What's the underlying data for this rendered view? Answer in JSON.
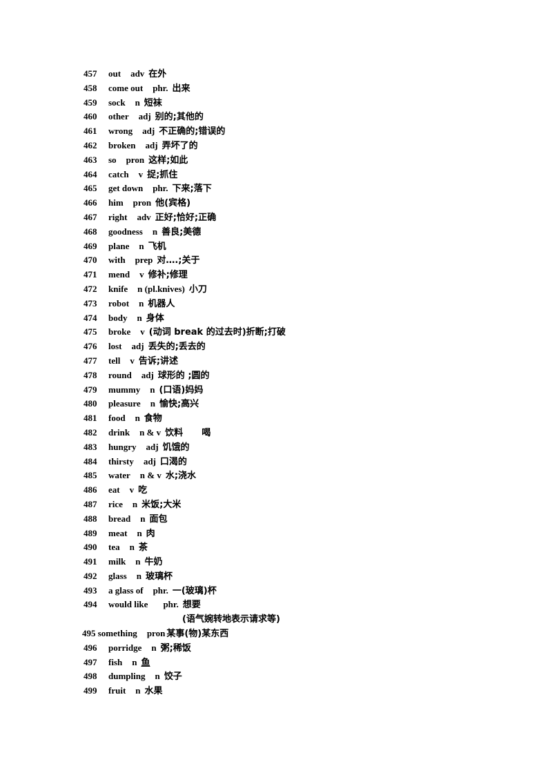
{
  "entries": [
    {
      "num": "457",
      "word": "out",
      "pos": "adv",
      "meaning": "在外"
    },
    {
      "num": "458",
      "word": "come out",
      "pos": "phr.",
      "meaning": "出来"
    },
    {
      "num": "459",
      "word": "sock",
      "pos": "n",
      "meaning": "短袜"
    },
    {
      "num": "460",
      "word": "other",
      "pos": "adj",
      "meaning": "别的;其他的"
    },
    {
      "num": "461",
      "word": "wrong",
      "pos": "adj",
      "meaning": "不正确的;错误的"
    },
    {
      "num": "462",
      "word": "broken",
      "pos": "adj",
      "meaning": "弄坏了的"
    },
    {
      "num": "463",
      "word": "so",
      "pos": "pron",
      "meaning": "这样;如此"
    },
    {
      "num": "464",
      "word": "catch",
      "pos": "v",
      "meaning": "捉;抓住"
    },
    {
      "num": "465",
      "word": "get down",
      "pos": "phr.",
      "meaning": "下来;落下"
    },
    {
      "num": "466",
      "word": "him",
      "pos": "pron",
      "meaning": "他(宾格)"
    },
    {
      "num": "467",
      "word": "right",
      "pos": "adv",
      "meaning": "正好;恰好;正确"
    },
    {
      "num": "468",
      "word": "goodness",
      "pos": "n",
      "meaning": "善良;美德"
    },
    {
      "num": "469",
      "word": "plane",
      "pos": "n",
      "meaning": "飞机"
    },
    {
      "num": "470",
      "word": "with",
      "pos": "prep",
      "meaning": "对….;关于"
    },
    {
      "num": "471",
      "word": "mend",
      "pos": "v",
      "meaning": "修补;修理"
    },
    {
      "num": "472",
      "word": "knife",
      "pos": "n (pl.knives)",
      "meaning": "小刀"
    },
    {
      "num": "473",
      "word": "robot",
      "pos": "n",
      "meaning": "机器人"
    },
    {
      "num": "474",
      "word": "body",
      "pos": "n",
      "meaning": "身体"
    },
    {
      "num": "475",
      "word": "broke",
      "pos": "v",
      "meaning": "(动词 break 的过去时)折断;打破"
    },
    {
      "num": "476",
      "word": "lost",
      "pos": "adj",
      "meaning": "丢失的;丢去的"
    },
    {
      "num": "477",
      "word": "tell",
      "pos": "v",
      "meaning": "告诉;讲述"
    },
    {
      "num": "478",
      "word": "round",
      "pos": "adj",
      "meaning": "球形的 ;圆的"
    },
    {
      "num": "479",
      "word": "mummy",
      "pos": "n",
      "meaning": "(口语)妈妈"
    },
    {
      "num": "480",
      "word": "pleasure",
      "pos": "n",
      "meaning": "愉快;高兴"
    },
    {
      "num": "481",
      "word": "food",
      "pos": "n",
      "meaning": "食物"
    },
    {
      "num": "482",
      "word": "drink",
      "pos": "n & v",
      "meaning": "饮料      喝"
    },
    {
      "num": "483",
      "word": "hungry",
      "pos": "adj",
      "meaning": "饥饿的"
    },
    {
      "num": "484",
      "word": "thirsty",
      "pos": "adj",
      "meaning": "口渴的"
    },
    {
      "num": "485",
      "word": "water",
      "pos": "n & v",
      "meaning": "水;浇水"
    },
    {
      "num": "486",
      "word": "eat",
      "pos": "v",
      "meaning": "吃"
    },
    {
      "num": "487",
      "word": "rice",
      "pos": "n",
      "meaning": "米饭;大米"
    },
    {
      "num": "488",
      "word": "bread",
      "pos": "n",
      "meaning": "面包"
    },
    {
      "num": "489",
      "word": "meat",
      "pos": "n",
      "meaning": "肉"
    },
    {
      "num": "490",
      "word": "tea",
      "pos": "n",
      "meaning": "茶"
    },
    {
      "num": "491",
      "word": "milk",
      "pos": "n",
      "meaning": "牛奶"
    },
    {
      "num": "492",
      "word": "glass",
      "pos": "n",
      "meaning": "玻璃杯"
    },
    {
      "num": "493",
      "word": "a glass of",
      "pos": "phr.",
      "meaning": "一(玻璃)杯"
    },
    {
      "num": "494",
      "word": "would like",
      "pos": "phr.",
      "meaning": "想要",
      "continuation": "(语气婉转地表示请求等)"
    },
    {
      "num": "495",
      "word": "something",
      "pos": "pron",
      "meaning": "某事(物)某东西"
    },
    {
      "num": "496",
      "word": "porridge",
      "pos": "n",
      "meaning": "粥;稀饭"
    },
    {
      "num": "497",
      "word": "fish",
      "pos": "n",
      "meaning": "鱼"
    },
    {
      "num": "498",
      "word": "dumpling",
      "pos": "n",
      "meaning": "饺子"
    },
    {
      "num": "499",
      "word": "fruit",
      "pos": "n",
      "meaning": "水果"
    }
  ]
}
